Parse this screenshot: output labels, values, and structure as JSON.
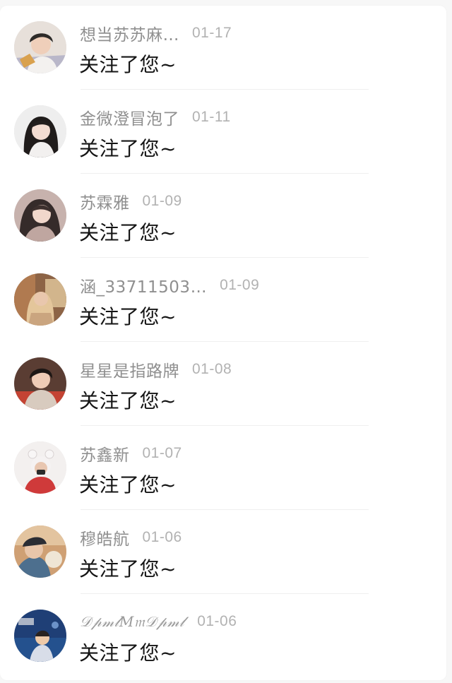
{
  "list": {
    "items": [
      {
        "name": "想当苏苏麻…",
        "date": "01-17",
        "message": "关注了您~"
      },
      {
        "name": "金微澄冒泡了",
        "date": "01-11",
        "message": "关注了您~"
      },
      {
        "name": "苏霖雅",
        "date": "01-09",
        "message": "关注了您~"
      },
      {
        "name": "涵_33711503…",
        "date": "01-09",
        "message": "关注了您~"
      },
      {
        "name": "星星是指路牌",
        "date": "01-08",
        "message": "关注了您~"
      },
      {
        "name": "苏鑫新",
        "date": "01-07",
        "message": "关注了您~"
      },
      {
        "name": "穆皓航",
        "date": "01-06",
        "message": "关注了您~"
      },
      {
        "name": "𝒟𝓅𝓂𝓁𝑀𝔪𝒟𝓅𝓂𝓁",
        "date": "01-06",
        "message": "关注了您~"
      }
    ]
  },
  "colors": {
    "name": "#8f8f8f",
    "date": "#b2b2b2",
    "message": "#151515",
    "background": "#f7f7f7"
  }
}
